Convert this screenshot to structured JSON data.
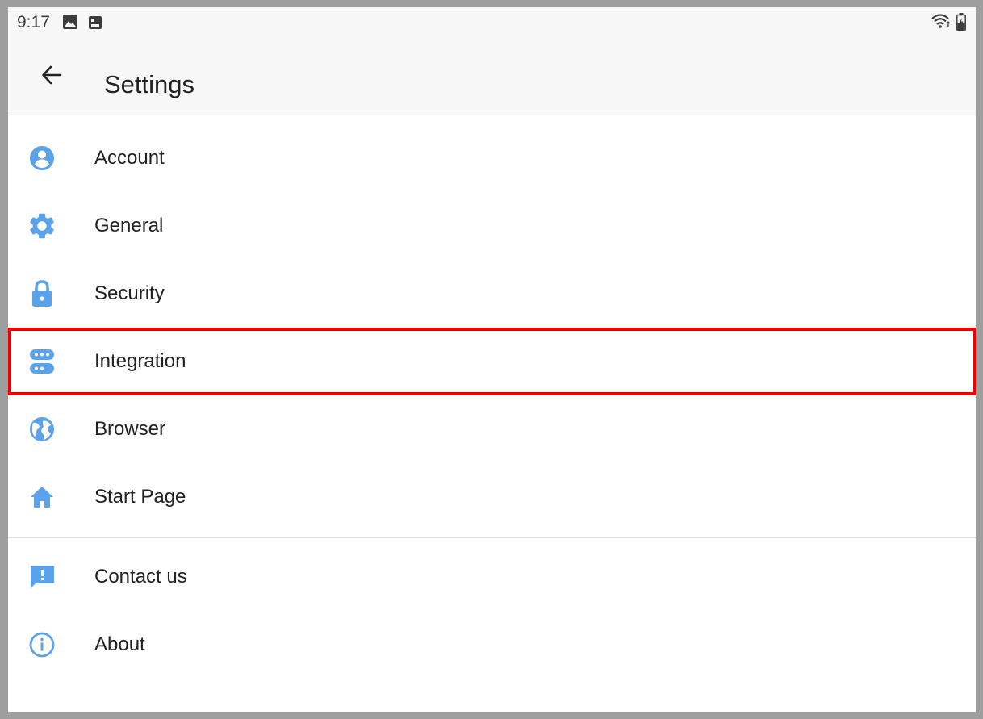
{
  "status_bar": {
    "time": "9:17",
    "left_icons": [
      "image-icon",
      "screenshot-icon"
    ],
    "right_icons": [
      "wifi-icon",
      "battery-icon"
    ]
  },
  "app_bar": {
    "back_icon": "arrow-left-icon",
    "title": "Settings"
  },
  "accent_color": "#5ba2ea",
  "highlight_color": "#ee0000",
  "menu": {
    "group_1": [
      {
        "label": "Account",
        "icon": "account-circle-icon"
      },
      {
        "label": "General",
        "icon": "gear-icon"
      },
      {
        "label": "Security",
        "icon": "lock-icon"
      },
      {
        "label": "Integration",
        "icon": "integration-icon",
        "highlighted": true
      },
      {
        "label": "Browser",
        "icon": "globe-icon"
      },
      {
        "label": "Start Page",
        "icon": "home-icon"
      }
    ],
    "group_2": [
      {
        "label": "Contact us",
        "icon": "feedback-icon"
      },
      {
        "label": "About",
        "icon": "info-icon"
      }
    ]
  }
}
